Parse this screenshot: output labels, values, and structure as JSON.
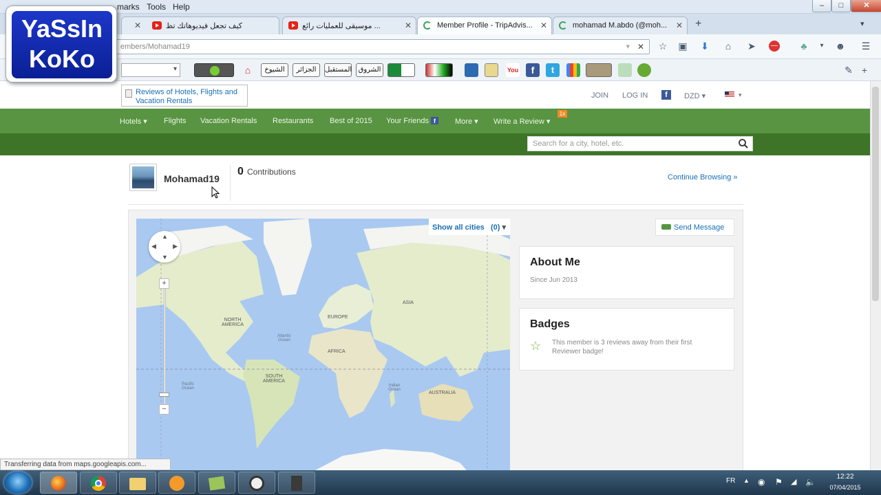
{
  "browser": {
    "menu": [
      "marks",
      "Tools",
      "Help"
    ],
    "window_controls": [
      "–",
      "□",
      "✕"
    ],
    "tabs": [
      {
        "title": "كيف تجعل فيديوهاتك تظ",
        "icon": "youtube-icon",
        "active": false
      },
      {
        "title": "موسيقى للعمليات رائع ...",
        "icon": "youtube-icon",
        "active": false
      },
      {
        "title": "Member Profile - TripAdvis...",
        "icon": "loading-icon",
        "active": true
      },
      {
        "title": "mohamad M.abdo (@moh...",
        "icon": "loading-icon",
        "active": false
      }
    ],
    "url": "embers/Mohamad19",
    "toolbar_buttons": [
      "الشيوخ",
      "الجزائر",
      "المستقبل",
      "الشروق"
    ],
    "status_text": "Transferring data from maps.googleapis.com..."
  },
  "logo": {
    "line1": "YaSsIn",
    "line2": "KoKo"
  },
  "site": {
    "logo_alt": "Reviews of Hotels, Flights and Vacation Rentals",
    "top_links": {
      "join": "JOIN",
      "login": "LOG IN",
      "currency": "DZD"
    },
    "nav": [
      "Hotels",
      "Flights",
      "Vacation Rentals",
      "Restaurants",
      "Best of 2015",
      "Your Friends",
      "More",
      "Write a Review"
    ],
    "review_badge": "1x",
    "search_placeholder": "Search for a city, hotel, etc."
  },
  "profile": {
    "username": "Mohamad19",
    "contributions_count": "0",
    "contributions_label": "Contributions",
    "continue_browsing": "Continue Browsing »",
    "show_all_cities": "Show all cities",
    "cities_count": "(0)",
    "send_message": "Send Message",
    "about_title": "About Me",
    "since": "Since Jun 2013",
    "badges_title": "Badges",
    "badge_text": "This member is 3 reviews away from their first Reviewer badge!"
  },
  "map": {
    "labels": [
      {
        "text": "NORTH AMERICA"
      },
      {
        "text": "EUROPE"
      },
      {
        "text": "ASIA"
      },
      {
        "text": "AFRICA"
      },
      {
        "text": "SOUTH AMERICA"
      },
      {
        "text": "AUSTRALIA"
      },
      {
        "text": "Atlantic Ocean"
      },
      {
        "text": "Pacific Ocean"
      },
      {
        "text": "Indian Ocean"
      }
    ],
    "zoom_in": "+",
    "zoom_out": "−"
  },
  "taskbar": {
    "lang": "FR",
    "time": "12:22",
    "date": "07/04/2015"
  }
}
